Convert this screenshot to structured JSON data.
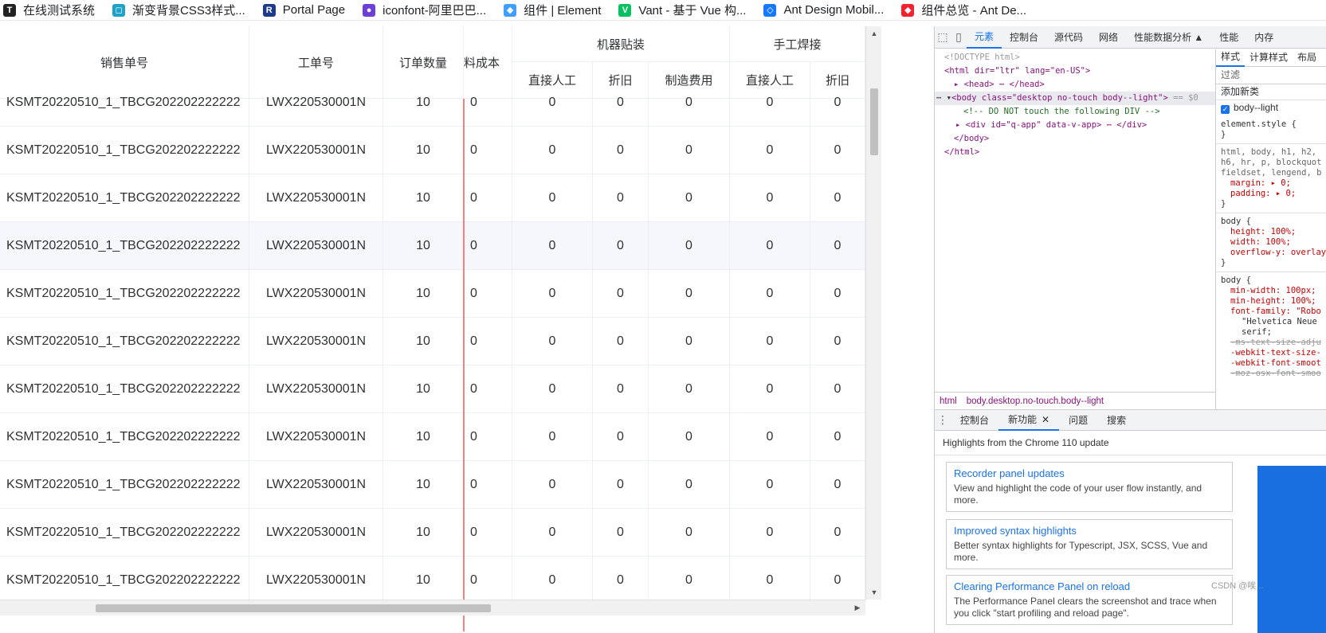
{
  "bookmarks": [
    {
      "label": "在线测试系统",
      "icon": "brand-logo-icon",
      "color": "#222222",
      "glyph": "T"
    },
    {
      "label": "渐变背景CSS3样式...",
      "icon": "gradient-site-icon",
      "color": "#1fa2c7",
      "glyph": "◻"
    },
    {
      "label": "Portal Page",
      "icon": "portal-r-icon",
      "color": "#1e3a8a",
      "glyph": "R"
    },
    {
      "label": "iconfont-阿里巴巴...",
      "icon": "iconfont-icon",
      "color": "#6e3ed8",
      "glyph": "●"
    },
    {
      "label": "组件 | Element",
      "icon": "element-icon",
      "color": "#409eff",
      "glyph": "◆"
    },
    {
      "label": "Vant - 基于 Vue 构...",
      "icon": "vant-icon",
      "color": "#07c160",
      "glyph": "V"
    },
    {
      "label": "Ant Design Mobil...",
      "icon": "ant-mobile-icon",
      "color": "#1677ff",
      "glyph": "◇"
    },
    {
      "label": "组件总览 - Ant De...",
      "icon": "ant-design-icon",
      "color": "#f5222d",
      "glyph": "◆"
    }
  ],
  "table": {
    "headers": {
      "sales_no": "销售单号",
      "work_no": "工单号",
      "qty": "订单数量",
      "material_cost": "料成本",
      "smt_group": "机器贴装",
      "hand_group": "手工焊接",
      "direct_labor": "直接人工",
      "depreciation": "折旧",
      "mfg_cost": "制造费用",
      "direct_labor_2": "直接人工",
      "depreciation_2": "折旧"
    },
    "rows": [
      {
        "sales_no": "KSMT20220510_1_TBCG202202222222",
        "work_no": "LWX220530001N",
        "qty": "10",
        "material": "0",
        "c1": "0",
        "c2": "0",
        "c3": "0",
        "c4": "0",
        "c5": "0"
      },
      {
        "sales_no": "KSMT20220510_1_TBCG202202222222",
        "work_no": "LWX220530001N",
        "qty": "10",
        "material": "0",
        "c1": "0",
        "c2": "0",
        "c3": "0",
        "c4": "0",
        "c5": "0"
      },
      {
        "sales_no": "KSMT20220510_1_TBCG202202222222",
        "work_no": "LWX220530001N",
        "qty": "10",
        "material": "0",
        "c1": "0",
        "c2": "0",
        "c3": "0",
        "c4": "0",
        "c5": "0"
      },
      {
        "sales_no": "KSMT20220510_1_TBCG202202222222",
        "work_no": "LWX220530001N",
        "qty": "10",
        "material": "0",
        "c1": "0",
        "c2": "0",
        "c3": "0",
        "c4": "0",
        "c5": "0"
      },
      {
        "sales_no": "KSMT20220510_1_TBCG202202222222",
        "work_no": "LWX220530001N",
        "qty": "10",
        "material": "0",
        "c1": "0",
        "c2": "0",
        "c3": "0",
        "c4": "0",
        "c5": "0"
      },
      {
        "sales_no": "KSMT20220510_1_TBCG202202222222",
        "work_no": "LWX220530001N",
        "qty": "10",
        "material": "0",
        "c1": "0",
        "c2": "0",
        "c3": "0",
        "c4": "0",
        "c5": "0"
      },
      {
        "sales_no": "KSMT20220510_1_TBCG202202222222",
        "work_no": "LWX220530001N",
        "qty": "10",
        "material": "0",
        "c1": "0",
        "c2": "0",
        "c3": "0",
        "c4": "0",
        "c5": "0"
      },
      {
        "sales_no": "KSMT20220510_1_TBCG202202222222",
        "work_no": "LWX220530001N",
        "qty": "10",
        "material": "0",
        "c1": "0",
        "c2": "0",
        "c3": "0",
        "c4": "0",
        "c5": "0"
      },
      {
        "sales_no": "KSMT20220510_1_TBCG202202222222",
        "work_no": "LWX220530001N",
        "qty": "10",
        "material": "0",
        "c1": "0",
        "c2": "0",
        "c3": "0",
        "c4": "0",
        "c5": "0"
      },
      {
        "sales_no": "KSMT20220510_1_TBCG202202222222",
        "work_no": "LWX220530001N",
        "qty": "10",
        "material": "0",
        "c1": "0",
        "c2": "0",
        "c3": "0",
        "c4": "0",
        "c5": "0"
      },
      {
        "sales_no": "KSMT20220510_1_TBCG202202222222",
        "work_no": "LWX220530001N",
        "qty": "10",
        "material": "0",
        "c1": "0",
        "c2": "0",
        "c3": "0",
        "c4": "0",
        "c5": "0"
      }
    ],
    "highlighted_row": 3
  },
  "devtools": {
    "tabs": [
      "元素",
      "控制台",
      "源代码",
      "网络",
      "性能数据分析 ▲",
      "性能",
      "内存"
    ],
    "active_tab": "元素",
    "dom": {
      "doctype": "<!DOCTYPE html>",
      "html_open": "<html dir=\"ltr\" lang=\"en-US\">",
      "head": "<head> ⋯ </head>",
      "body_open": "<body class=\"desktop no-touch body--light\">",
      "body_marker": "== $0",
      "comment": "<!-- DO NOT touch the following DIV -->",
      "div": "<div id=\"q-app\" data-v-app> ⋯ </div>",
      "body_close": "</body>",
      "html_close": "</html>"
    },
    "breadcrumbs": [
      "html",
      "body.desktop.no-touch.body--light"
    ],
    "styles": {
      "tabs": [
        "样式",
        "计算样式",
        "布局"
      ],
      "filter_placeholder": "过滤",
      "add_class": "添加新类",
      "class_toggle": "body--light",
      "element_style": "element.style {",
      "rule1_selector": "html, body, h1, h2, h6, hr, p, blockquot fieldset, lengend, b",
      "rule1_props": [
        "margin: ▸ 0;",
        "padding: ▸ 0;"
      ],
      "rule2_selector": "body {",
      "rule2_props": [
        "height: 100%;",
        "width: 100%;",
        "overflow-y: overlay"
      ],
      "rule3_selector": "body {",
      "rule3_props": [
        "min-width: 100px;",
        "min-height: 100%;",
        "font-family: \"Robo",
        "\"Helvetica Neue",
        "serif;"
      ],
      "rule3_struck": [
        "-ms-text-size-adju",
        "-webkit-text-size-",
        "-webkit-font-smoot",
        "-moz-osx-font-smoo"
      ]
    },
    "drawer": {
      "tabs": [
        "控制台",
        "新功能",
        "问题",
        "搜索"
      ],
      "active_tab": "新功能",
      "highlights_title": "Highlights from the Chrome 110 update",
      "cards": [
        {
          "title": "Recorder panel updates",
          "desc": "View and highlight the code of your user flow instantly, and more."
        },
        {
          "title": "Improved syntax highlights",
          "desc": "Better syntax highlights for Typescript, JSX, SCSS, Vue and more."
        },
        {
          "title": "Clearing Performance Panel on reload",
          "desc": "The Performance Panel clears the screenshot and trace when you click \"start profiling and reload page\"."
        }
      ]
    }
  },
  "watermark": "CSDN @唉..."
}
